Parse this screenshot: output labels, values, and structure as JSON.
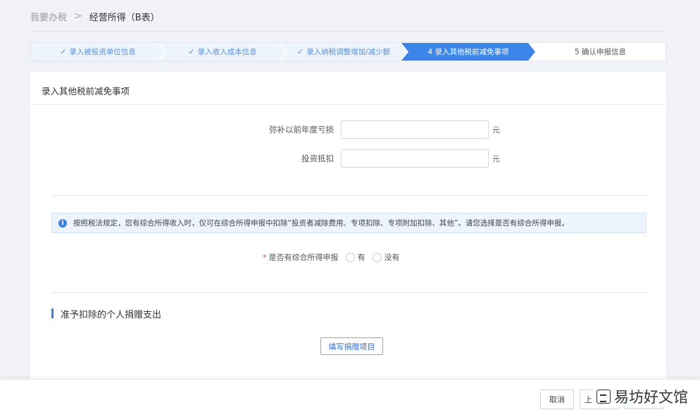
{
  "breadcrumb": {
    "home": "我要办税",
    "separator": ">",
    "current": "经营所得（B表）"
  },
  "steps": [
    {
      "label": "录入被投资单位信息",
      "status": "done",
      "check": "✓"
    },
    {
      "label": "录入收入成本信息",
      "status": "done",
      "check": "✓"
    },
    {
      "label": "录入纳税调整增加/减少额",
      "status": "done",
      "check": "✓"
    },
    {
      "label": "4 录入其他税前减免事项",
      "status": "active"
    },
    {
      "label": "5 确认申报信息",
      "status": "todo"
    }
  ],
  "card": {
    "title": "录入其他税前减免事项"
  },
  "form": {
    "loss": {
      "label": "弥补以前年度亏损",
      "value": "",
      "unit": "元"
    },
    "investment": {
      "label": "投资抵扣",
      "value": "",
      "unit": "元"
    }
  },
  "notice": {
    "icon": "info-icon",
    "text": "按照税法规定，您有综合所得收入时，仅可在综合所得申报中扣除“投资者减除费用、专项扣除、专项附加扣除、其他”。请您选择是否有综合所得申报。"
  },
  "comprehensive_income": {
    "required_mark": "*",
    "label": "是否有综合所得申报",
    "options": [
      "有",
      "没有"
    ]
  },
  "donation": {
    "section_title": "准予扣除的个人捐赠支出",
    "button": "填写捐赠项目"
  },
  "footer": {
    "cancel": "取消",
    "prev": "上",
    "next": ""
  },
  "watermark": {
    "text": "易坊好文馆"
  },
  "colors": {
    "accent": "#3b86e8",
    "step_done_bg": "#eef4fc",
    "required": "#e6522c"
  }
}
